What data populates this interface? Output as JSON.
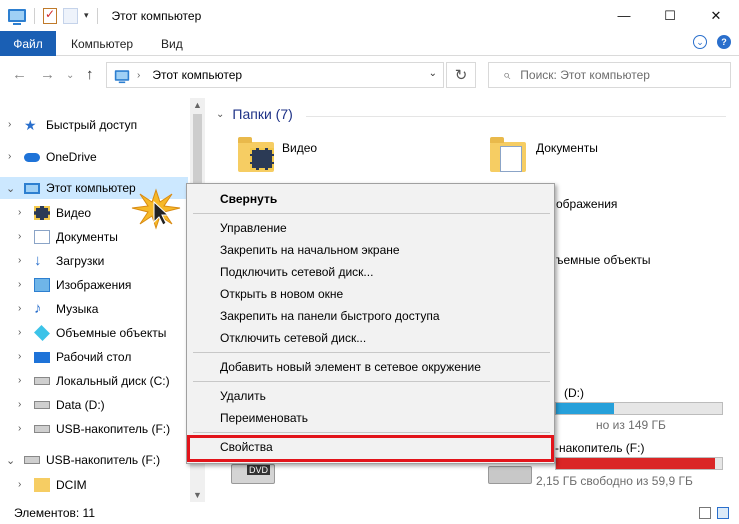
{
  "window": {
    "title": "Этот компьютер",
    "controls": {
      "minimize": "—",
      "maximize": "☐",
      "close": "✕"
    }
  },
  "ribbon": {
    "tabs": [
      "Файл",
      "Компьютер",
      "Вид"
    ],
    "expand_icon": "⌄",
    "help_icon": "?"
  },
  "nav": {
    "back": "←",
    "forward": "→",
    "recent": "⌄",
    "up": "↑",
    "address": "Этот компьютер",
    "address_sep": "›",
    "refresh": "↻",
    "search_placeholder": "Поиск: Этот компьютер"
  },
  "navpane": {
    "items": [
      {
        "label": "Быстрый доступ",
        "icon": "star-icon"
      },
      {
        "label": "OneDrive",
        "icon": "cloud-icon"
      },
      {
        "label": "Этот компьютер",
        "icon": "computer-icon"
      },
      {
        "label": "Видео",
        "icon": "video-folder-icon"
      },
      {
        "label": "Документы",
        "icon": "documents-folder-icon"
      },
      {
        "label": "Загрузки",
        "icon": "downloads-icon"
      },
      {
        "label": "Изображения",
        "icon": "pictures-folder-icon"
      },
      {
        "label": "Музыка",
        "icon": "music-icon"
      },
      {
        "label": "Объемные объекты",
        "icon": "3d-objects-icon"
      },
      {
        "label": "Рабочий стол",
        "icon": "desktop-icon"
      },
      {
        "label": "Локальный диск (C:)",
        "icon": "drive-icon"
      },
      {
        "label": "Data (D:)",
        "icon": "drive-icon"
      },
      {
        "label": "USB-накопитель (F:)",
        "icon": "usb-drive-icon"
      },
      {
        "label": "USB-накопитель (F:)",
        "icon": "usb-drive-icon"
      },
      {
        "label": "DCIM",
        "icon": "folder-icon"
      }
    ]
  },
  "content": {
    "group_title": "Папки (7)",
    "folders": {
      "video": "Видео",
      "documents": "Документы",
      "pictures_partial": "ображения",
      "objects_partial": "ъемные объекты"
    },
    "drives": {
      "d_label_partial": "(D:)",
      "d_used": 0.35,
      "d_free_partial": "но из 149 ГБ",
      "f_label_partial": "-накопитель (F:)",
      "f_used": 0.96,
      "f_free": "2,15 ГБ свободно из 59,9 ГБ",
      "dvd_label": "DVD"
    },
    "colors": {
      "drive_ok": "#26a0da",
      "drive_full": "#da2626"
    }
  },
  "context_menu": {
    "bold_item": "Свернуть",
    "group1": [
      "Управление",
      "Закрепить на начальном экране",
      "Подключить сетевой диск...",
      "Открыть в новом окне",
      "Закрепить на панели быстрого доступа",
      "Отключить сетевой диск..."
    ],
    "group2": [
      "Добавить новый элемент в сетевое окружение"
    ],
    "group3": [
      "Удалить",
      "Переименовать"
    ],
    "properties": "Свойства",
    "highlight_color": "#e2141b"
  },
  "status": {
    "items_count": "Элементов: 11"
  }
}
